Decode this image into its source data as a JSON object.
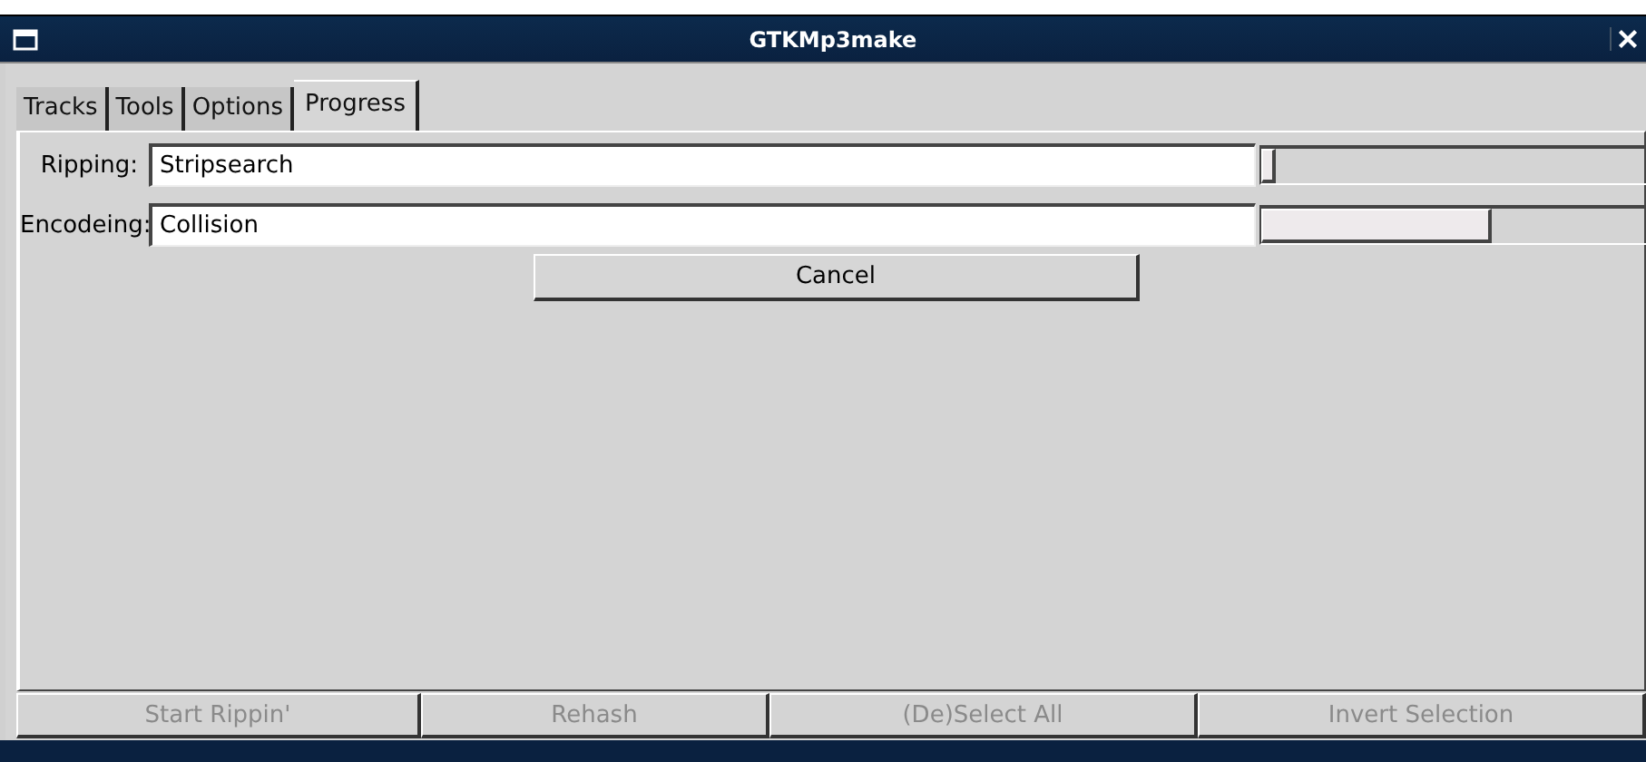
{
  "window": {
    "title": "GTKMp3make"
  },
  "tabs": [
    {
      "label": "Tracks",
      "selected": false
    },
    {
      "label": "Tools",
      "selected": false
    },
    {
      "label": "Options",
      "selected": false
    },
    {
      "label": "Progress",
      "selected": true
    }
  ],
  "progress": [
    {
      "label": "Ripping:",
      "value": "Stripsearch",
      "level": 0.04
    },
    {
      "label": "Encodeing:",
      "value": "Collision",
      "level": 0.6
    }
  ],
  "cancel_button": "Cancel",
  "buttons": [
    {
      "label": "Start Rippin'",
      "disabled": true
    },
    {
      "label": "Rehash",
      "disabled": true
    },
    {
      "label": "(De)Select All",
      "disabled": true
    },
    {
      "label": "Invert Selection",
      "disabled": true
    }
  ]
}
